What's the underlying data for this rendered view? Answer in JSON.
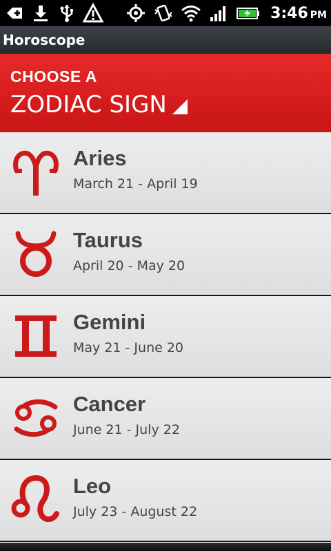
{
  "status_bar": {
    "time": "3:46",
    "ampm": "PM",
    "left_icons": [
      "notification-plus-icon",
      "download-icon",
      "usb-icon",
      "warning-icon"
    ],
    "right_icons": [
      "gps-icon",
      "vibrate-icon",
      "wifi-icon",
      "signal-icon",
      "battery-charging-icon"
    ]
  },
  "title_bar": {
    "title": "Horoscope"
  },
  "header": {
    "line1": "CHOOSE A",
    "line2": "ZODIAC SIGN",
    "accent_color": "#d71d1d"
  },
  "signs": [
    {
      "name": "Aries",
      "dates": "March 21 - April 19",
      "icon": "aries-icon"
    },
    {
      "name": "Taurus",
      "dates": "April 20 - May 20",
      "icon": "taurus-icon"
    },
    {
      "name": "Gemini",
      "dates": "May 21 - June 20",
      "icon": "gemini-icon"
    },
    {
      "name": "Cancer",
      "dates": "June 21 - July 22",
      "icon": "cancer-icon"
    },
    {
      "name": "Leo",
      "dates": "July 23 - August 22",
      "icon": "leo-icon"
    }
  ],
  "colors": {
    "symbol_red": "#cc1a1a",
    "text_gray": "#444444"
  }
}
